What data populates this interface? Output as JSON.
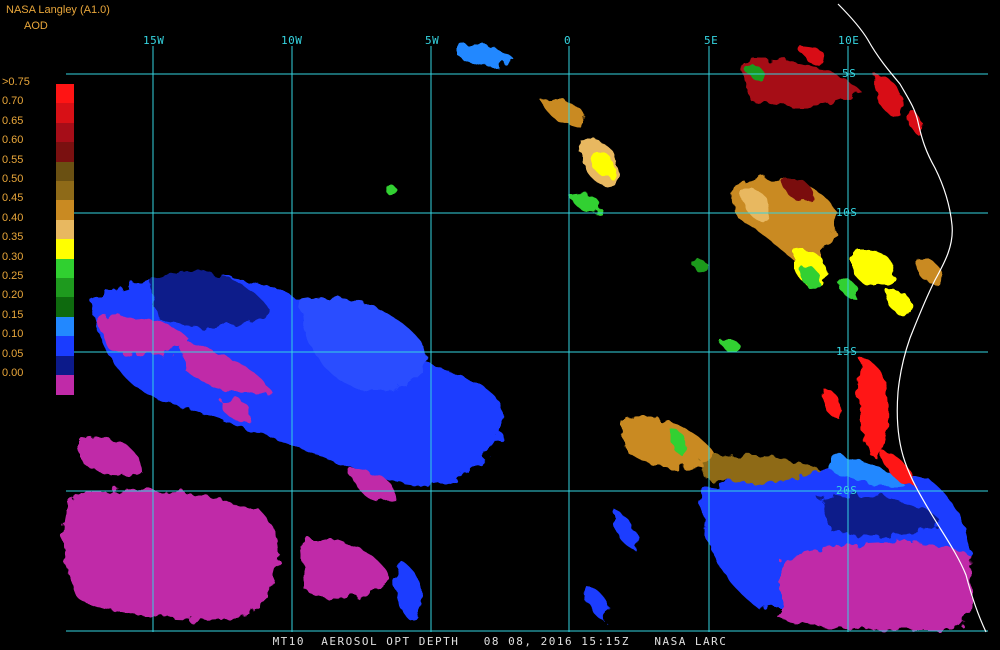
{
  "header": {
    "source": "NASA Langley (A1.0)",
    "product": "AOD"
  },
  "legend": {
    "labels": [
      ">0.75",
      "0.70",
      "0.65",
      "0.60",
      "0.55",
      "0.50",
      "0.45",
      "0.40",
      "0.35",
      "0.30",
      "0.25",
      "0.20",
      "0.15",
      "0.10",
      "0.05",
      "0.00"
    ],
    "colors": [
      "#ff1414",
      "#d81016",
      "#a60d18",
      "#7a1010",
      "#6a5012",
      "#8e6a18",
      "#c98a22",
      "#e8b860",
      "#ffff00",
      "#30d030",
      "#1e9a1e",
      "#0e6a0e",
      "#2288ff",
      "#1a3cff",
      "#0c1a8a",
      "#c02aa8"
    ]
  },
  "grid": {
    "lon_labels": [
      "15W",
      "10W",
      "5W",
      "0",
      "5E",
      "10E"
    ],
    "lat_labels": [
      "5S",
      "10S",
      "15S",
      "20S"
    ]
  },
  "caption": "MT10  AEROSOL OPT DEPTH   08 08, 2016 15:15Z   NASA LARC"
}
